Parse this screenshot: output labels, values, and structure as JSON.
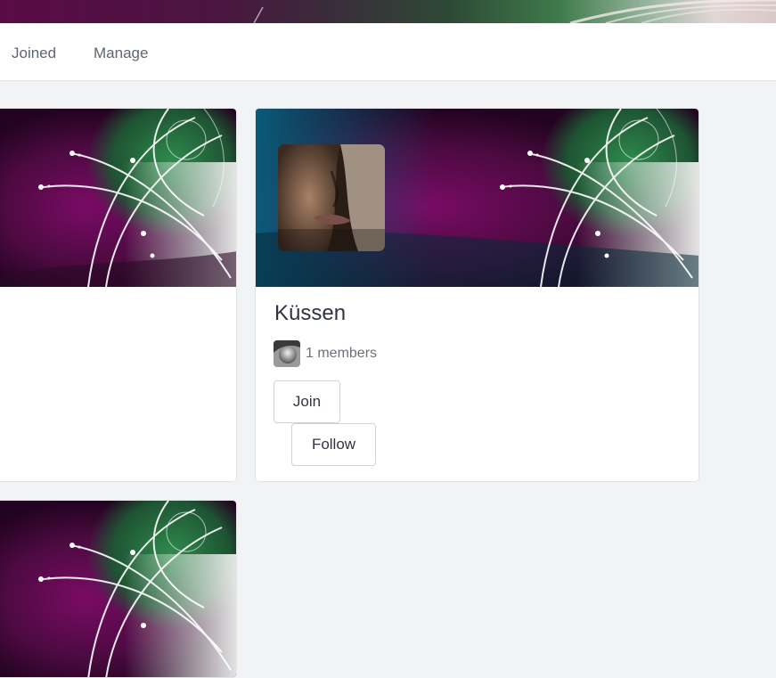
{
  "tabs": [
    {
      "label": "Joined"
    },
    {
      "label": "Manage"
    }
  ],
  "group": {
    "title": "Küssen",
    "members_text": "1 members",
    "join_label": "Join",
    "follow_label": "Follow"
  },
  "colors": {
    "cover_purple": "#6a0a58",
    "cover_green": "#2f7a45",
    "cover_teal": "#0b4a63",
    "border": "#cfd3d8",
    "page_bg": "#f2f3f5"
  },
  "icons": {
    "cover": "floral-swirl-cover-image",
    "group_avatar": "kiss-photo-avatar",
    "member_avatar": "member-photo-avatar"
  }
}
